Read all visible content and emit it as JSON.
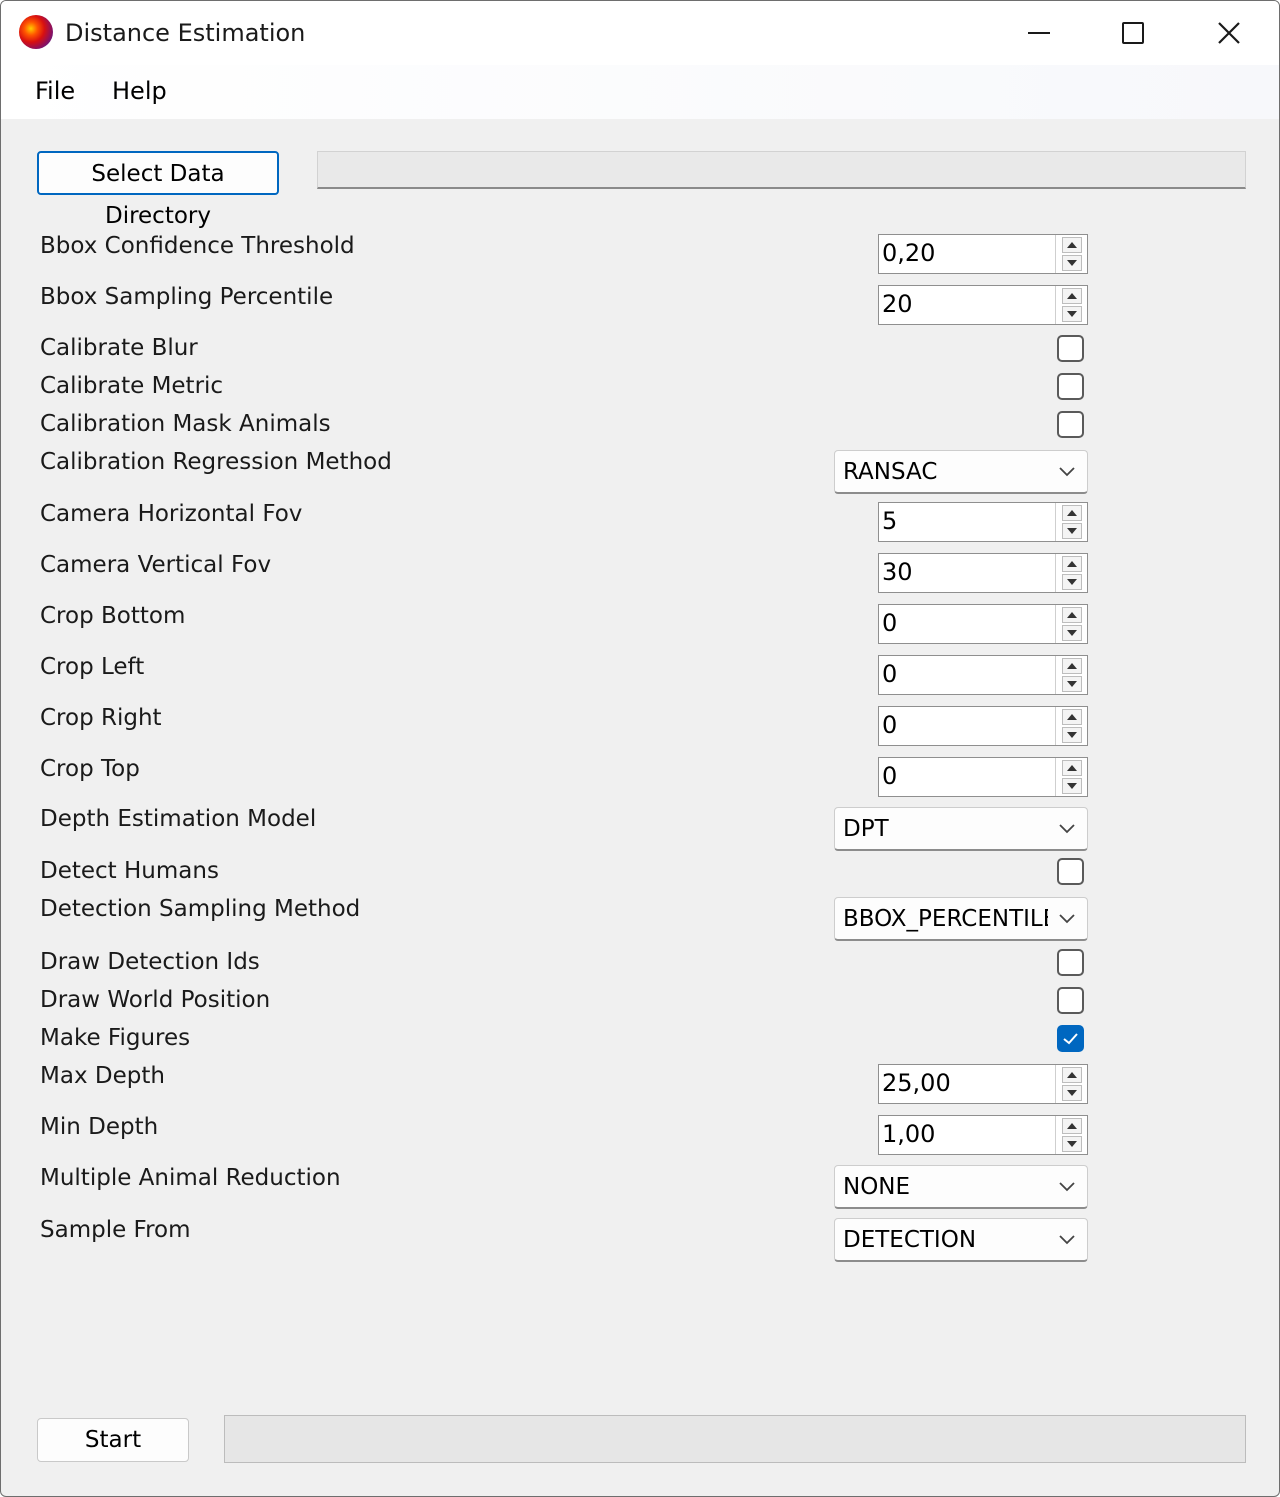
{
  "window": {
    "title": "Distance Estimation",
    "controls": {
      "minimize": "minimize-icon",
      "maximize": "maximize-icon",
      "close": "close-icon"
    }
  },
  "menu": {
    "file": "File",
    "help": "Help"
  },
  "data_dir": {
    "button_label": "Select Data Directory",
    "path": ""
  },
  "settings": {
    "bbox_confidence_threshold": {
      "label": "Bbox Confidence Threshold",
      "value": "0,20"
    },
    "bbox_sampling_percentile": {
      "label": "Bbox Sampling Percentile",
      "value": "20"
    },
    "calibrate_blur": {
      "label": "Calibrate Blur",
      "checked": false
    },
    "calibrate_metric": {
      "label": "Calibrate Metric",
      "checked": false
    },
    "calibration_mask_animals": {
      "label": "Calibration Mask Animals",
      "checked": false
    },
    "calibration_regression_method": {
      "label": "Calibration Regression Method",
      "value": "RANSAC"
    },
    "camera_horizontal_fov": {
      "label": "Camera Horizontal Fov",
      "value": "5"
    },
    "camera_vertical_fov": {
      "label": "Camera Vertical Fov",
      "value": "30"
    },
    "crop_bottom": {
      "label": "Crop Bottom",
      "value": "0"
    },
    "crop_left": {
      "label": "Crop Left",
      "value": "0"
    },
    "crop_right": {
      "label": "Crop Right",
      "value": "0"
    },
    "crop_top": {
      "label": "Crop Top",
      "value": "0"
    },
    "depth_estimation_model": {
      "label": "Depth Estimation Model",
      "value": "DPT"
    },
    "detect_humans": {
      "label": "Detect Humans",
      "checked": false
    },
    "detection_sampling_method": {
      "label": "Detection Sampling Method",
      "value": "BBOX_PERCENTILE"
    },
    "draw_detection_ids": {
      "label": "Draw Detection Ids",
      "checked": false
    },
    "draw_world_position": {
      "label": "Draw World Position",
      "checked": false
    },
    "make_figures": {
      "label": "Make Figures",
      "checked": true
    },
    "max_depth": {
      "label": "Max Depth",
      "value": "25,00"
    },
    "min_depth": {
      "label": "Min Depth",
      "value": "1,00"
    },
    "multiple_animal_reduction": {
      "label": "Multiple Animal Reduction",
      "value": "NONE"
    },
    "sample_from": {
      "label": "Sample From",
      "value": "DETECTION"
    }
  },
  "footer": {
    "start_label": "Start",
    "progress": 0
  },
  "colors": {
    "accent": "#0067c0",
    "window_bg": "#f0f0f0"
  }
}
